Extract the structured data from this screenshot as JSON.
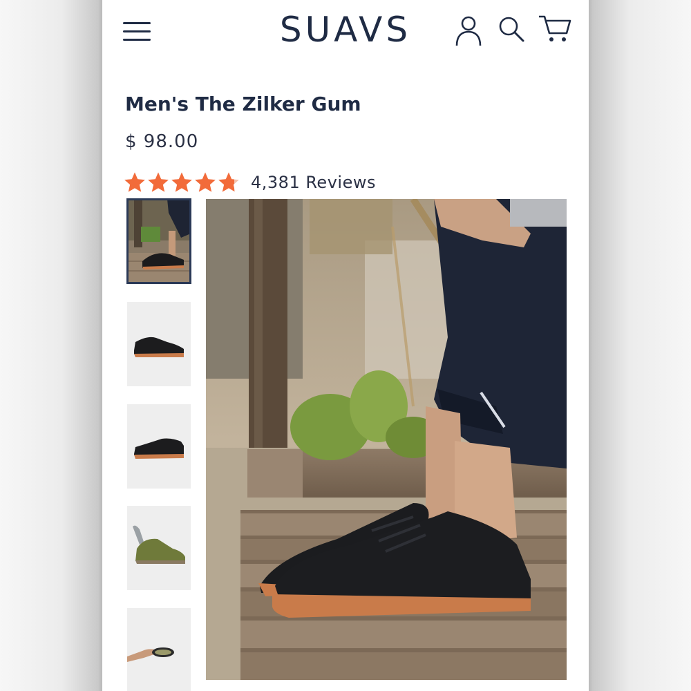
{
  "header": {
    "brand": "SUAVS",
    "icons": [
      "menu-icon",
      "account-icon",
      "search-icon",
      "cart-icon"
    ]
  },
  "product": {
    "title": "Men's The Zilker Gum",
    "price": "$ 98.00",
    "rating": 4.75,
    "rating_max": 5,
    "reviews_label": "4,381 Reviews"
  },
  "gallery": {
    "thumbnails": [
      {
        "label": "lifestyle-on-bench",
        "active": true
      },
      {
        "label": "black-gum-side",
        "active": false
      },
      {
        "label": "black-gum-side-alt",
        "active": false
      },
      {
        "label": "olive-with-insole",
        "active": false
      },
      {
        "label": "hand-bending-sole",
        "active": false
      }
    ],
    "main_image": "black-sneakers-on-wooden-bench"
  },
  "colors": {
    "brand_navy": "#1f2b44",
    "star_orange": "#f26b3a",
    "gum_sole": "#c97b4a"
  }
}
